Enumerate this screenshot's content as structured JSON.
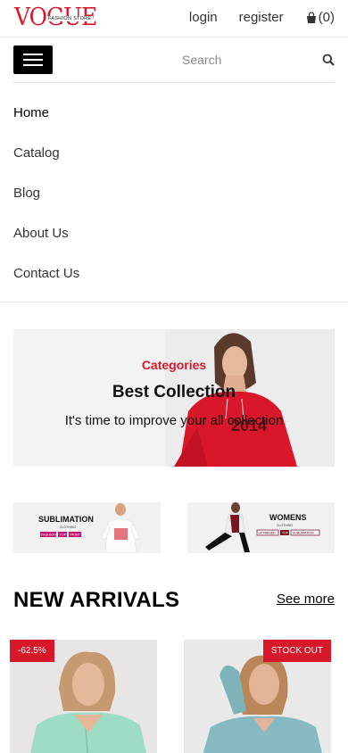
{
  "header": {
    "logo_text": "VOGUE",
    "logo_subtext": "FASHION STORE",
    "login_label": "login",
    "register_label": "register",
    "cart_count": "(0)",
    "brand_color": "#d7182a"
  },
  "search": {
    "placeholder": "Search"
  },
  "nav": {
    "items": [
      {
        "label": "Home"
      },
      {
        "label": "Catalog"
      },
      {
        "label": "Blog"
      },
      {
        "label": "About Us"
      },
      {
        "label": "Contact Us"
      }
    ]
  },
  "banner": {
    "category": "Categories",
    "title": "Best Collection",
    "subtitle": "It's time to improve your all collection",
    "image_text": "2014"
  },
  "promos": {
    "left": {
      "heading": "SUBLIMATION",
      "small": "CLOTHING",
      "tags": [
        "FASHION",
        "TOP",
        "PRINT"
      ]
    },
    "right": {
      "heading": "WOMENS",
      "small": "CLOTHING",
      "tags": [
        "UPTIMISED",
        "TOP",
        "SUBLIMATION"
      ]
    }
  },
  "arrivals": {
    "title": "NEW ARRIVALS",
    "see_more": "See more",
    "products": [
      {
        "badge": "-62.5%"
      },
      {
        "badge": "STOCK OUT"
      }
    ]
  }
}
